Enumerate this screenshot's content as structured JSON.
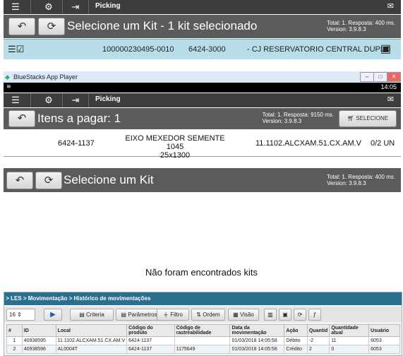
{
  "colors": {
    "topbar": "#3d3d3d",
    "header": "#5b5b5b",
    "selected_row": "#b7dde8",
    "les_header": "#2b6f8f"
  },
  "common": {
    "app_title": "Picking",
    "stat_line1": "Total: 1. Resposta: 400 ms.",
    "version": "Version: 3.9.8.3"
  },
  "panel1": {
    "title": "Selecione um Kit - 1 kit selecionado",
    "row": {
      "code": "100000230495-0010",
      "ref": "6424-3000",
      "desc": "- CJ RESERVATORIO CENTRAL DUPLO"
    }
  },
  "panel2": {
    "window_title": "BlueStacks App Player",
    "time": "14:05",
    "title": "Itens a pagar: 1",
    "stat_line1": "Total: 1. Resposta: 9150 ms.",
    "select_label": "SELECIONE",
    "item": {
      "code": "6424-1137",
      "desc_line1": "EIXO MEXEDOR SEMENTE 1045",
      "desc_line2": "25x1300",
      "location": "11.1102.ALCXAM.51.CX.AM.V",
      "qty": "0/2 UN"
    }
  },
  "panel3": {
    "title": "Selecione um Kit",
    "empty_message": "Não foram encontrados kits"
  },
  "panel4": {
    "breadcrumb": "> LES > Movimentação > Histórico de movimentações",
    "page_size": "16",
    "buttons": {
      "criteria": "Criteria",
      "params": "Parâmetros",
      "filter": "Filtro",
      "order": "Ordem",
      "view": "Visão"
    },
    "columns": [
      "#",
      "ID",
      "Local",
      "Código do produto",
      "Código de rastreabilidade",
      "Data da movimentação",
      "Ação",
      "Quantid",
      "Quantidade atual",
      "Usuário"
    ],
    "rows": [
      [
        "1",
        "40938595",
        "11.1102.ALCXAM.51.CX.AM.V",
        "6424-1137",
        "",
        "01/03/2018 14:05:58",
        "Débito",
        "-2",
        "11",
        "6053"
      ],
      [
        "2",
        "40938596",
        "AL0004T",
        "6424-1137",
        "1175649",
        "01/03/2018 14:05:58",
        "Crédito",
        "2",
        "0",
        "6053"
      ]
    ]
  }
}
